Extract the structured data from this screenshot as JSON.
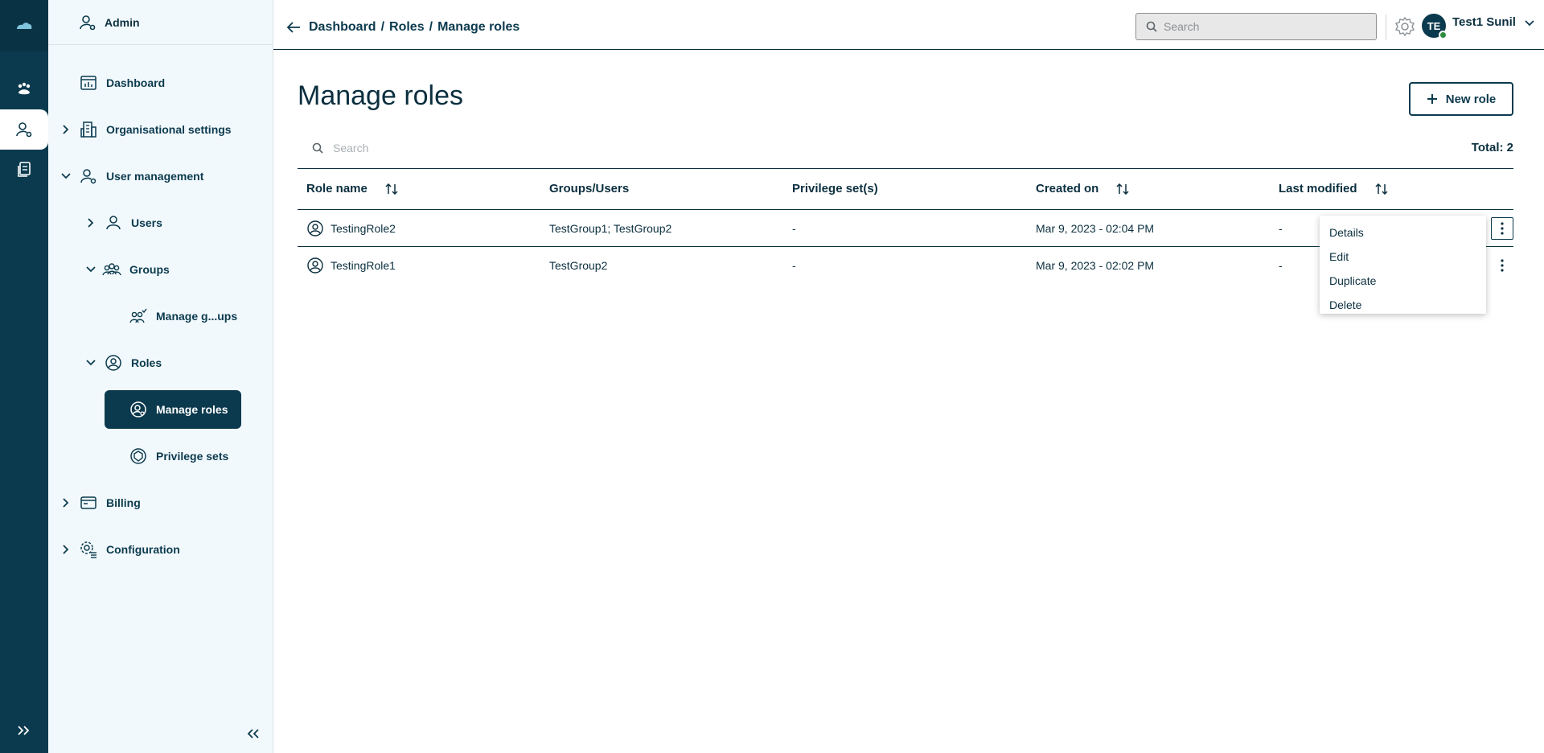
{
  "breadcrumb": {
    "items": [
      "Dashboard",
      "Roles",
      "Manage roles"
    ],
    "separator": "/"
  },
  "topbar": {
    "search_placeholder": "Search",
    "avatar_initials": "TE",
    "user_name": "Test1 Sunil"
  },
  "sidebar": {
    "header": "Admin",
    "items": [
      {
        "label": "Dashboard"
      },
      {
        "label": "Organisational settings"
      },
      {
        "label": "User management"
      },
      {
        "label": "Users"
      },
      {
        "label": "Groups"
      },
      {
        "label": "Manage g...ups"
      },
      {
        "label": "Roles"
      },
      {
        "label": "Manage roles"
      },
      {
        "label": "Privilege sets"
      },
      {
        "label": "Billing"
      },
      {
        "label": "Configuration"
      }
    ]
  },
  "main": {
    "title": "Manage roles",
    "new_role_label": "New role",
    "search_placeholder": "Search",
    "total_label": "Total: 2",
    "columns": [
      "Role name",
      "Groups/Users",
      "Privilege set(s)",
      "Created on",
      "Last modified"
    ],
    "rows": [
      {
        "role": "TestingRole2",
        "groups": "TestGroup1; TestGroup2",
        "privileges": "-",
        "created": "Mar 9, 2023 - 02:04 PM",
        "modified": "-"
      },
      {
        "role": "TestingRole1",
        "groups": "TestGroup2",
        "privileges": "-",
        "created": "Mar 9, 2023 - 02:02 PM",
        "modified": "-"
      }
    ]
  },
  "context_menu": {
    "items": [
      "Details",
      "Edit",
      "Duplicate",
      "Delete"
    ]
  },
  "colors": {
    "brand_dark": "#0b3a4e",
    "sidebar_bg": "#f2f9fc",
    "status_online": "#2e8b3e"
  }
}
